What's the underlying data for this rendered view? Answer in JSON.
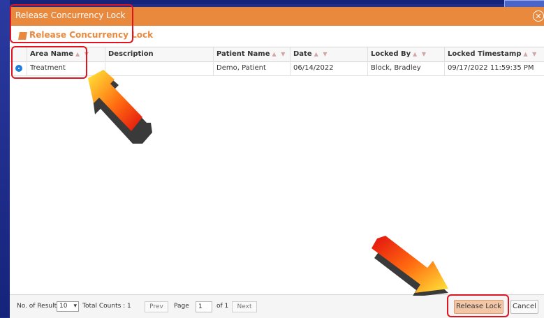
{
  "dialog": {
    "title": "Release Concurrency Lock",
    "close_icon": "close-icon",
    "subtitle": "Release Concurrency Lock"
  },
  "table": {
    "columns": [
      {
        "label": "Area Name",
        "sort": "▲ ▼"
      },
      {
        "label": "Description",
        "sort": ""
      },
      {
        "label": "Patient Name",
        "sort": "▲ ▼"
      },
      {
        "label": "Date",
        "sort": "▲ ▼"
      },
      {
        "label": "Locked By",
        "sort": "▲ ▼"
      },
      {
        "label": "Locked Timestamp",
        "sort": "▲ ▼"
      }
    ],
    "rows": [
      {
        "selected": true,
        "area_name": "Treatment",
        "description": "",
        "patient_name": "Demo, Patient",
        "date": "06/14/2022",
        "locked_by": "Block, Bradley",
        "locked_timestamp": "09/17/2022 11:59:35 PM"
      }
    ]
  },
  "footer": {
    "no_of_result_label": "No. of Result",
    "page_size": "10",
    "total_counts_label": "Total Counts :",
    "total_counts": "1",
    "prev_label": "Prev",
    "page_label": "Page",
    "page_number": "1",
    "of_label": "of 1",
    "next_label": "Next",
    "release_lock_label": "Release Lock",
    "cancel_label": "Cancel"
  },
  "colors": {
    "accent": "#e8893e",
    "highlight": "#e0141e",
    "radio": "#1e7ee0"
  }
}
